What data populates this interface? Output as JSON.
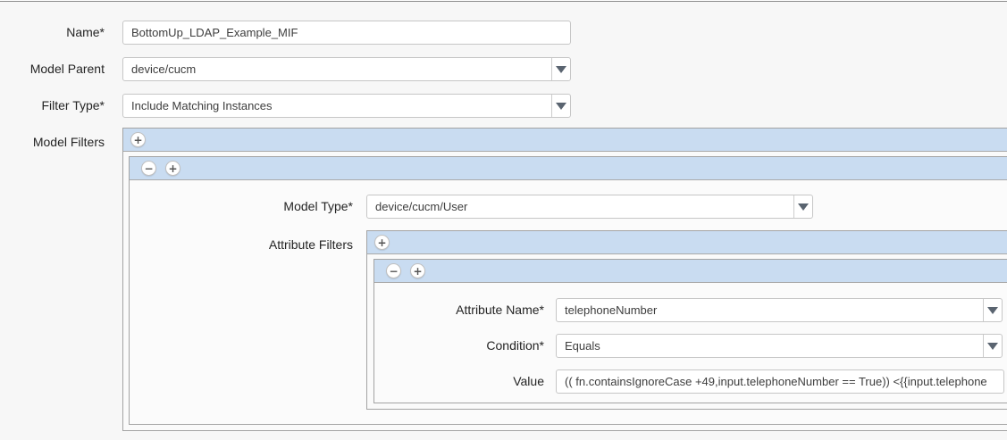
{
  "colors": {
    "toolbar_blue": "#c9dcf1",
    "panel_border": "#a3a3a3",
    "page_background": "#f7f7f7",
    "arrow_gray": "#5a6470"
  },
  "controls": {
    "add_label": "+",
    "remove_label": "−"
  },
  "form": {
    "name": {
      "label": "Name*",
      "value": "BottomUp_LDAP_Example_MIF"
    },
    "model_parent": {
      "label": "Model Parent",
      "value": "device/cucm"
    },
    "filter_type": {
      "label": "Filter Type*",
      "value": "Include Matching Instances"
    },
    "model_filters": {
      "label": "Model Filters",
      "item": {
        "model_type": {
          "label": "Model Type*",
          "value": "device/cucm/User"
        },
        "attribute_filters": {
          "label": "Attribute Filters",
          "item": {
            "attribute_name": {
              "label": "Attribute Name*",
              "value": "telephoneNumber"
            },
            "condition": {
              "label": "Condition*",
              "value": "Equals"
            },
            "value": {
              "label": "Value",
              "value": "(( fn.containsIgnoreCase +49,input.telephoneNumber == True)) <{{input.telephone"
            }
          }
        }
      }
    }
  }
}
